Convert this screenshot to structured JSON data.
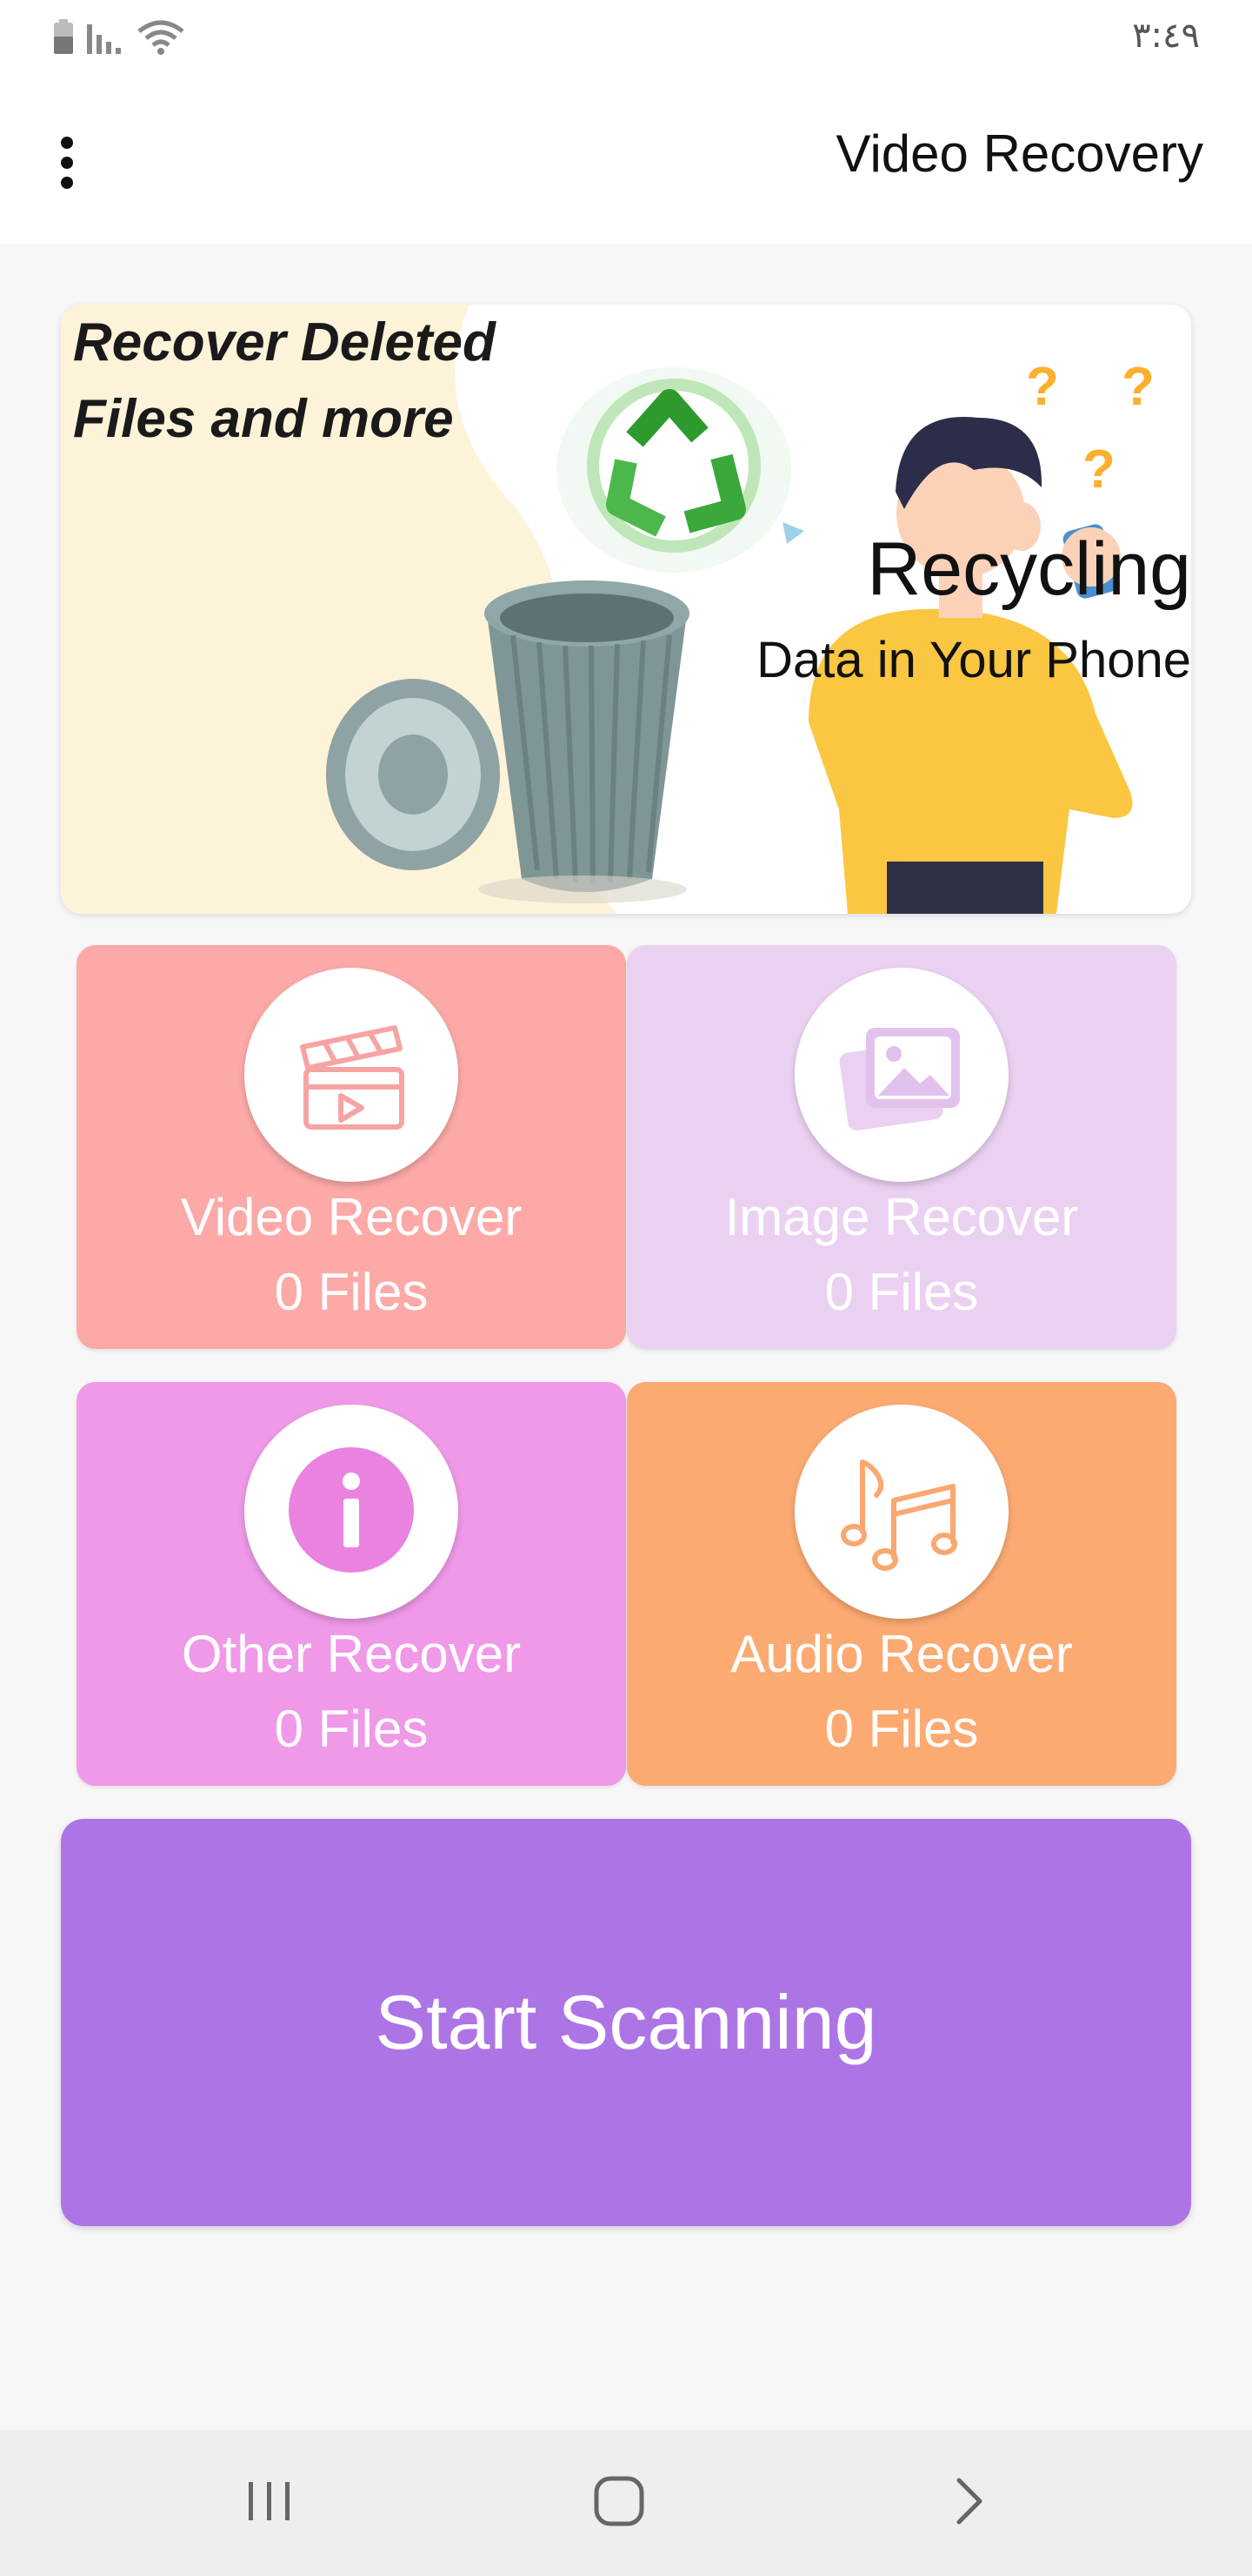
{
  "status_bar": {
    "time": "٣:٤٩",
    "icons": [
      "battery-icon",
      "signal-icon",
      "wifi-icon"
    ]
  },
  "app_bar": {
    "title": "Video Recovery",
    "menu_icon": "more-vert-icon"
  },
  "banner": {
    "headline_line1": "Recover Deleted",
    "headline_line2": "Files and more",
    "title": "Recycling",
    "subtitle": "Data in Your Phone"
  },
  "cards": [
    {
      "label": "Video Recover",
      "count": "0 Files",
      "icon": "clapperboard-icon",
      "color": "#fca9a8"
    },
    {
      "label": "Image Recover",
      "count": "0 Files",
      "icon": "image-stack-icon",
      "color": "#ead1f1"
    },
    {
      "label": "Other Recover",
      "count": "0 Files",
      "icon": "info-icon",
      "color": "#ef99e8"
    },
    {
      "label": "Audio Recover",
      "count": "0 Files",
      "icon": "music-note-icon",
      "color": "#fcaa72"
    }
  ],
  "start_button": {
    "label": "Start Scanning",
    "color": "#ad74e6"
  },
  "nav_bar": {
    "icons": [
      "recents-icon",
      "home-icon",
      "back-icon"
    ]
  }
}
